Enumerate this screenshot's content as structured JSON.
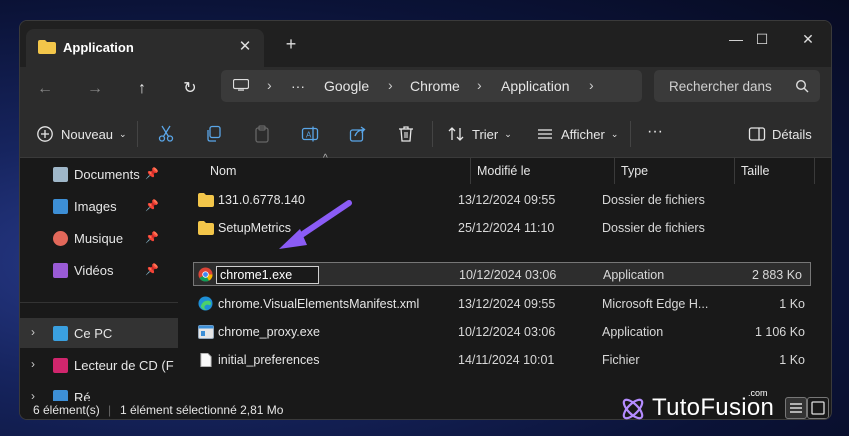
{
  "tab": {
    "title": "Application",
    "close": "✕",
    "new": "+"
  },
  "window_controls": {
    "minimize": "—",
    "maximize": "☐",
    "close": "✕"
  },
  "nav": {
    "back": "←",
    "forward": "→",
    "up": "↑",
    "refresh": "↻"
  },
  "breadcrumb": {
    "more": "···",
    "items": [
      "Google",
      "Chrome",
      "Application"
    ]
  },
  "search": {
    "placeholder": "Rechercher dans"
  },
  "toolbar": {
    "new_label": "Nouveau",
    "sort_label": "Trier",
    "view_label": "Afficher",
    "more": "···",
    "details_label": "Détails"
  },
  "sidebar": {
    "items": [
      {
        "label": "Documents",
        "icon": "document-icon",
        "pinned": true
      },
      {
        "label": "Images",
        "icon": "image-icon",
        "pinned": true
      },
      {
        "label": "Musique",
        "icon": "music-icon",
        "pinned": true
      },
      {
        "label": "Vidéos",
        "icon": "video-icon",
        "pinned": true
      },
      {
        "label": "Ce PC",
        "icon": "pc-icon",
        "selected": true
      },
      {
        "label": "Lecteur de CD (F",
        "icon": "cd-drive-icon"
      },
      {
        "label": "Ré",
        "icon": "network-icon"
      }
    ]
  },
  "columns": {
    "name": "Nom",
    "modified": "Modifié le",
    "type": "Type",
    "size": "Taille"
  },
  "files": [
    {
      "name": "131.0.6778.140",
      "modified": "13/12/2024 09:55",
      "type": "Dossier de fichiers",
      "size": "",
      "icon": "folder-icon"
    },
    {
      "name": "SetupMetrics",
      "modified": "25/12/2024 11:10",
      "type": "Dossier de fichiers",
      "size": "",
      "icon": "folder-icon"
    },
    {
      "name": "chrome1.exe",
      "modified": "10/12/2024 03:06",
      "type": "Application",
      "size": "2 883 Ko",
      "icon": "chrome-icon",
      "renaming": true
    },
    {
      "name": "chrome.VisualElementsManifest.xml",
      "modified": "13/12/2024 09:55",
      "type": "Microsoft Edge H...",
      "size": "1 Ko",
      "icon": "edge-icon"
    },
    {
      "name": "chrome_proxy.exe",
      "modified": "10/12/2024 03:06",
      "type": "Application",
      "size": "1 106 Ko",
      "icon": "exe-icon"
    },
    {
      "name": "initial_preferences",
      "modified": "14/11/2024 10:01",
      "type": "Fichier",
      "size": "1 Ko",
      "icon": "file-icon"
    }
  ],
  "status": {
    "count": "6 élément(s)",
    "selection": "1 élément sélectionné  2,81 Mo"
  },
  "watermark": {
    "brand": "TutoFusion",
    "suffix": ".com"
  },
  "colors": {
    "accent": "#8b5cf6",
    "folder": "#f3c64a",
    "selection_border": "#777777"
  }
}
